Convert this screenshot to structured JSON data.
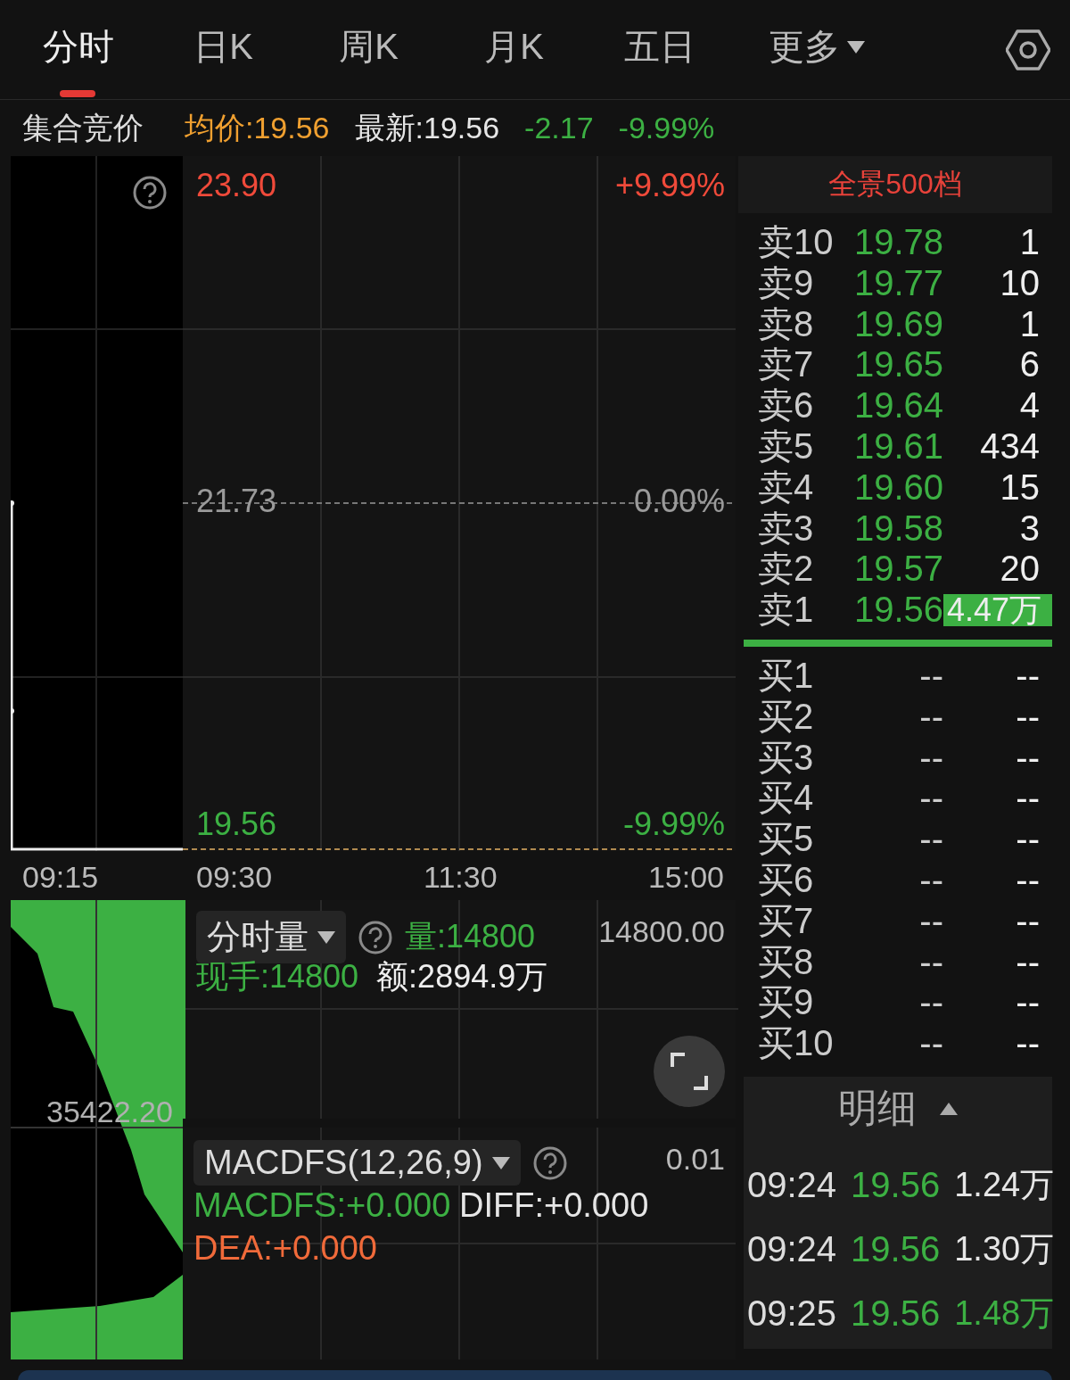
{
  "tabs": [
    {
      "label": "分时",
      "selected": true,
      "dropdown": false
    },
    {
      "label": "日K",
      "selected": false,
      "dropdown": false
    },
    {
      "label": "周K",
      "selected": false,
      "dropdown": false
    },
    {
      "label": "月K",
      "selected": false,
      "dropdown": false
    },
    {
      "label": "五日",
      "selected": false,
      "dropdown": false
    },
    {
      "label": "更多",
      "selected": false,
      "dropdown": true
    }
  ],
  "quote": {
    "status": "集合竞价",
    "items": [
      {
        "text": "均价:19.56",
        "color": "#f0a030"
      },
      {
        "text": "最新:19.56",
        "color": "#e6e6e6"
      },
      {
        "text": "-2.17",
        "color": "#3cb043"
      },
      {
        "text": "-9.99%",
        "color": "#3cb043"
      }
    ]
  },
  "price_chart": {
    "upper_price": "23.90",
    "upper_pct": "+9.99%",
    "mid_price": "21.73",
    "mid_pct": "0.00%",
    "lower_price": "19.56",
    "lower_pct": "-9.99%",
    "times": [
      "09:15",
      "09:30",
      "11:30",
      "15:00"
    ]
  },
  "volume_panel": {
    "indicator": "分时量",
    "volume": "量:14800",
    "max": "14800.00",
    "current": "现手:14800",
    "amount": "额:2894.9万",
    "auction_max": "35422.20"
  },
  "macd_panel": {
    "indicator": "MACDFS(12,26,9)",
    "max": "0.01",
    "values": [
      {
        "text": "MACDFS:+0.000",
        "color": "#3cb043"
      },
      {
        "text": "DIFF:+0.000",
        "color": "#e6e6e6"
      },
      {
        "text": "DEA:+0.000",
        "color": "#f06a3a"
      }
    ]
  },
  "order_book": {
    "title": "全景500档",
    "asks": [
      {
        "label": "卖10",
        "price": "19.78",
        "volume": "1",
        "highlighted": false
      },
      {
        "label": "卖9",
        "price": "19.77",
        "volume": "10",
        "highlighted": false
      },
      {
        "label": "卖8",
        "price": "19.69",
        "volume": "1",
        "highlighted": false
      },
      {
        "label": "卖7",
        "price": "19.65",
        "volume": "6",
        "highlighted": false
      },
      {
        "label": "卖6",
        "price": "19.64",
        "volume": "4",
        "highlighted": false
      },
      {
        "label": "卖5",
        "price": "19.61",
        "volume": "434",
        "highlighted": false
      },
      {
        "label": "卖4",
        "price": "19.60",
        "volume": "15",
        "highlighted": false
      },
      {
        "label": "卖3",
        "price": "19.58",
        "volume": "3",
        "highlighted": false
      },
      {
        "label": "卖2",
        "price": "19.57",
        "volume": "20",
        "highlighted": false
      },
      {
        "label": "卖1",
        "price": "19.56",
        "volume": "4.47万",
        "highlighted": true
      }
    ],
    "bids": [
      {
        "label": "买1",
        "price": "--",
        "volume": "--"
      },
      {
        "label": "买2",
        "price": "--",
        "volume": "--"
      },
      {
        "label": "买3",
        "price": "--",
        "volume": "--"
      },
      {
        "label": "买4",
        "price": "--",
        "volume": "--"
      },
      {
        "label": "买5",
        "price": "--",
        "volume": "--"
      },
      {
        "label": "买6",
        "price": "--",
        "volume": "--"
      },
      {
        "label": "买7",
        "price": "--",
        "volume": "--"
      },
      {
        "label": "买8",
        "price": "--",
        "volume": "--"
      },
      {
        "label": "买9",
        "price": "--",
        "volume": "--"
      },
      {
        "label": "买10",
        "price": "--",
        "volume": "--"
      }
    ]
  },
  "detail": {
    "title": "明细",
    "trades": [
      {
        "time": "09:24",
        "price": "19.56",
        "volume": "1.24万",
        "color": "#e6e6e6"
      },
      {
        "time": "09:24",
        "price": "19.56",
        "volume": "1.30万",
        "color": "#e6e6e6"
      },
      {
        "time": "09:25",
        "price": "19.56",
        "volume": "1.48万",
        "color": "#3cb043"
      }
    ]
  }
}
